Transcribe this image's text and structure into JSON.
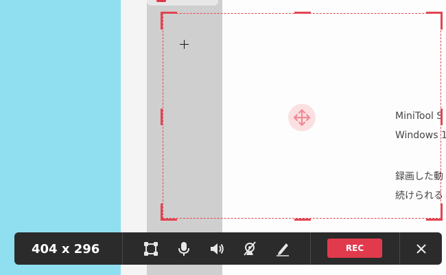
{
  "page_text": {
    "line1": "MiniTool S",
    "line2": "Windows 1",
    "line3": "録画した動",
    "line4": "続けられる"
  },
  "toolbar": {
    "size_readout": "404 x 296",
    "rec_label": "REC",
    "region_tool": "region-icon",
    "mic_tool": "microphone-icon",
    "speaker_tool": "speaker-icon",
    "camera_tool": "webcam-off-icon",
    "pen_tool": "pen-icon",
    "close_tool": "close-icon"
  },
  "colors": {
    "desktop": "#8fdff0",
    "accent": "#e24450",
    "toolbar_bg": "#2b2b2b",
    "rec_button": "#e23a4d"
  }
}
